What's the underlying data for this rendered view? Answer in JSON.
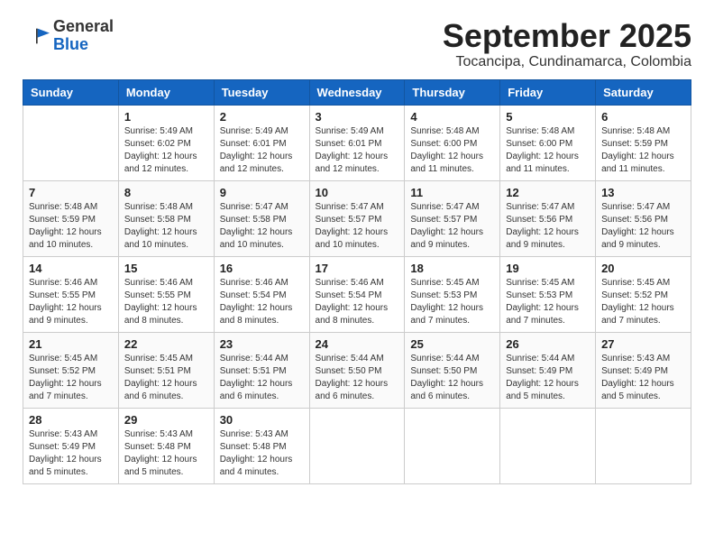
{
  "header": {
    "logo_general": "General",
    "logo_blue": "Blue",
    "month_title": "September 2025",
    "subtitle": "Tocancipa, Cundinamarca, Colombia"
  },
  "weekdays": [
    "Sunday",
    "Monday",
    "Tuesday",
    "Wednesday",
    "Thursday",
    "Friday",
    "Saturday"
  ],
  "weeks": [
    [
      {
        "day": "",
        "info": ""
      },
      {
        "day": "1",
        "info": "Sunrise: 5:49 AM\nSunset: 6:02 PM\nDaylight: 12 hours\nand 12 minutes."
      },
      {
        "day": "2",
        "info": "Sunrise: 5:49 AM\nSunset: 6:01 PM\nDaylight: 12 hours\nand 12 minutes."
      },
      {
        "day": "3",
        "info": "Sunrise: 5:49 AM\nSunset: 6:01 PM\nDaylight: 12 hours\nand 12 minutes."
      },
      {
        "day": "4",
        "info": "Sunrise: 5:48 AM\nSunset: 6:00 PM\nDaylight: 12 hours\nand 11 minutes."
      },
      {
        "day": "5",
        "info": "Sunrise: 5:48 AM\nSunset: 6:00 PM\nDaylight: 12 hours\nand 11 minutes."
      },
      {
        "day": "6",
        "info": "Sunrise: 5:48 AM\nSunset: 5:59 PM\nDaylight: 12 hours\nand 11 minutes."
      }
    ],
    [
      {
        "day": "7",
        "info": "Sunrise: 5:48 AM\nSunset: 5:59 PM\nDaylight: 12 hours\nand 10 minutes."
      },
      {
        "day": "8",
        "info": "Sunrise: 5:48 AM\nSunset: 5:58 PM\nDaylight: 12 hours\nand 10 minutes."
      },
      {
        "day": "9",
        "info": "Sunrise: 5:47 AM\nSunset: 5:58 PM\nDaylight: 12 hours\nand 10 minutes."
      },
      {
        "day": "10",
        "info": "Sunrise: 5:47 AM\nSunset: 5:57 PM\nDaylight: 12 hours\nand 10 minutes."
      },
      {
        "day": "11",
        "info": "Sunrise: 5:47 AM\nSunset: 5:57 PM\nDaylight: 12 hours\nand 9 minutes."
      },
      {
        "day": "12",
        "info": "Sunrise: 5:47 AM\nSunset: 5:56 PM\nDaylight: 12 hours\nand 9 minutes."
      },
      {
        "day": "13",
        "info": "Sunrise: 5:47 AM\nSunset: 5:56 PM\nDaylight: 12 hours\nand 9 minutes."
      }
    ],
    [
      {
        "day": "14",
        "info": "Sunrise: 5:46 AM\nSunset: 5:55 PM\nDaylight: 12 hours\nand 9 minutes."
      },
      {
        "day": "15",
        "info": "Sunrise: 5:46 AM\nSunset: 5:55 PM\nDaylight: 12 hours\nand 8 minutes."
      },
      {
        "day": "16",
        "info": "Sunrise: 5:46 AM\nSunset: 5:54 PM\nDaylight: 12 hours\nand 8 minutes."
      },
      {
        "day": "17",
        "info": "Sunrise: 5:46 AM\nSunset: 5:54 PM\nDaylight: 12 hours\nand 8 minutes."
      },
      {
        "day": "18",
        "info": "Sunrise: 5:45 AM\nSunset: 5:53 PM\nDaylight: 12 hours\nand 7 minutes."
      },
      {
        "day": "19",
        "info": "Sunrise: 5:45 AM\nSunset: 5:53 PM\nDaylight: 12 hours\nand 7 minutes."
      },
      {
        "day": "20",
        "info": "Sunrise: 5:45 AM\nSunset: 5:52 PM\nDaylight: 12 hours\nand 7 minutes."
      }
    ],
    [
      {
        "day": "21",
        "info": "Sunrise: 5:45 AM\nSunset: 5:52 PM\nDaylight: 12 hours\nand 7 minutes."
      },
      {
        "day": "22",
        "info": "Sunrise: 5:45 AM\nSunset: 5:51 PM\nDaylight: 12 hours\nand 6 minutes."
      },
      {
        "day": "23",
        "info": "Sunrise: 5:44 AM\nSunset: 5:51 PM\nDaylight: 12 hours\nand 6 minutes."
      },
      {
        "day": "24",
        "info": "Sunrise: 5:44 AM\nSunset: 5:50 PM\nDaylight: 12 hours\nand 6 minutes."
      },
      {
        "day": "25",
        "info": "Sunrise: 5:44 AM\nSunset: 5:50 PM\nDaylight: 12 hours\nand 6 minutes."
      },
      {
        "day": "26",
        "info": "Sunrise: 5:44 AM\nSunset: 5:49 PM\nDaylight: 12 hours\nand 5 minutes."
      },
      {
        "day": "27",
        "info": "Sunrise: 5:43 AM\nSunset: 5:49 PM\nDaylight: 12 hours\nand 5 minutes."
      }
    ],
    [
      {
        "day": "28",
        "info": "Sunrise: 5:43 AM\nSunset: 5:49 PM\nDaylight: 12 hours\nand 5 minutes."
      },
      {
        "day": "29",
        "info": "Sunrise: 5:43 AM\nSunset: 5:48 PM\nDaylight: 12 hours\nand 5 minutes."
      },
      {
        "day": "30",
        "info": "Sunrise: 5:43 AM\nSunset: 5:48 PM\nDaylight: 12 hours\nand 4 minutes."
      },
      {
        "day": "",
        "info": ""
      },
      {
        "day": "",
        "info": ""
      },
      {
        "day": "",
        "info": ""
      },
      {
        "day": "",
        "info": ""
      }
    ]
  ]
}
